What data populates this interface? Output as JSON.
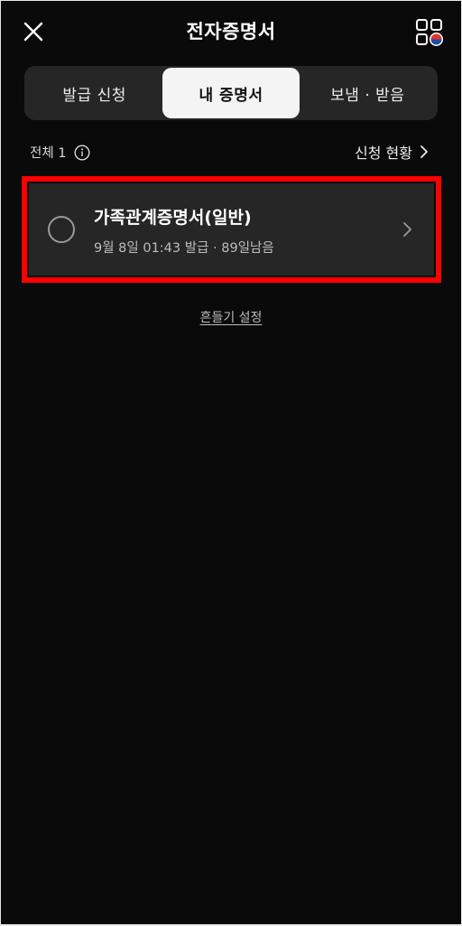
{
  "header": {
    "title": "전자증명서",
    "close_icon": "close-icon",
    "menu_icon": "grid-menu-icon"
  },
  "tabs": [
    {
      "label": "발급 신청",
      "active": false
    },
    {
      "label": "내 증명서",
      "active": true
    },
    {
      "label": "보냄 · 받음",
      "active": false
    }
  ],
  "summary": {
    "total_label": "전체 1",
    "status_link": "신청 현황"
  },
  "certificates": [
    {
      "title": "가족관계증명서(일반)",
      "subtitle": "9월 8일 01:43 발급 · 89일남음"
    }
  ],
  "footer": {
    "shake_settings": "흔들기 설정"
  },
  "colors": {
    "background": "#0a0a0a",
    "tab_bar": "#262626",
    "active_tab": "#f4f4f4",
    "card": "#262626",
    "highlight": "#ff0000"
  }
}
